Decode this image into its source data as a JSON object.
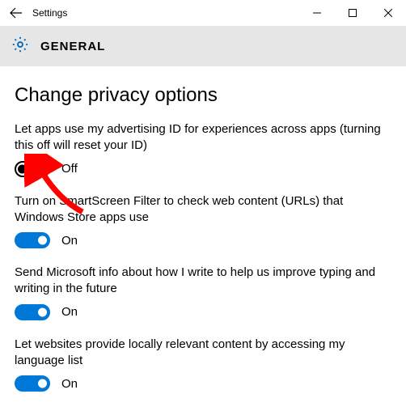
{
  "window": {
    "title": "Settings"
  },
  "header": {
    "label": "GENERAL"
  },
  "page": {
    "title": "Change privacy options"
  },
  "options": [
    {
      "desc": "Let apps use my advertising ID for experiences across apps (turning this off will reset your ID)",
      "state": "off",
      "state_label": "Off"
    },
    {
      "desc": "Turn on SmartScreen Filter to check web content (URLs) that Windows Store apps use",
      "state": "on",
      "state_label": "On"
    },
    {
      "desc": "Send Microsoft info about how I write to help us improve typing and writing in the future",
      "state": "on",
      "state_label": "On"
    },
    {
      "desc": "Let websites provide locally relevant content by accessing my language list",
      "state": "on",
      "state_label": "On"
    }
  ],
  "colors": {
    "accent": "#0078d7",
    "header_bg": "#e6e6e6",
    "gear": "#0065b3",
    "arrow": "#ff0000"
  }
}
